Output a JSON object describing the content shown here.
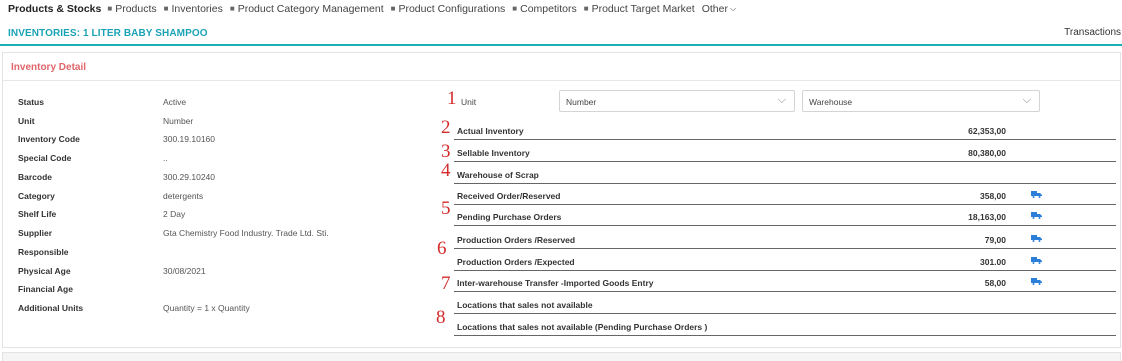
{
  "nav": {
    "brand": "Products & Stocks",
    "items": [
      "Products",
      "Inventories",
      "Product Category Management",
      "Product Configurations",
      "Competitors",
      "Product Target Market"
    ],
    "other": "Other"
  },
  "page": {
    "title": "INVENTORIES: 1 LITER BABY SHAMPOO",
    "transactions": "Transactions"
  },
  "panel": {
    "title": "Inventory Detail"
  },
  "details": [
    {
      "label": "Status",
      "value": "Active"
    },
    {
      "label": "Unit",
      "value": "Number"
    },
    {
      "label": "Inventory Code",
      "value": "300.19.10160"
    },
    {
      "label": "Special Code",
      "value": ".."
    },
    {
      "label": "Barcode",
      "value": "300.29.10240"
    },
    {
      "label": "Category",
      "value": "detergents"
    },
    {
      "label": "Shelf Life",
      "value": "2 Day"
    },
    {
      "label": "Supplier",
      "value": "Gta Chemistry Food Industry. Trade Ltd. Sti."
    },
    {
      "label": "Responsible",
      "value": ""
    },
    {
      "label": "Physical Age",
      "value": "30/08/2021"
    },
    {
      "label": "Financial Age",
      "value": ""
    },
    {
      "label": "Additional Units",
      "value": "Quantity = 1 x Quantity"
    }
  ],
  "unit_filter": {
    "label": "Unit",
    "unit_value": "Number",
    "warehouse_value": "Warehouse"
  },
  "annotations": [
    "1",
    "2",
    "3",
    "4",
    "5",
    "6",
    "7",
    "8"
  ],
  "inventory_rows": [
    {
      "label": "Actual Inventory",
      "value": "62,353,00",
      "truck": false
    },
    {
      "label": "Sellable Inventory",
      "value": "80,380,00",
      "truck": false
    },
    {
      "label": "Warehouse of Scrap",
      "value": "",
      "truck": false
    },
    {
      "label": "Received Order/Reserved",
      "value": "358,00",
      "truck": true
    },
    {
      "label": "Pending Purchase Orders",
      "value": "18,163,00",
      "truck": true
    },
    {
      "label": "Production Orders /Reserved",
      "value": "79,00",
      "truck": true
    },
    {
      "label": "Production Orders /Expected",
      "value": "301.00",
      "truck": true
    },
    {
      "label": "Inter-warehouse Transfer -Imported Goods Entry",
      "value": "58,00",
      "truck": true
    },
    {
      "label": "Locations that sales not available",
      "value": "",
      "truck": false
    },
    {
      "label": "Locations that sales not available (Pending Purchase Orders )",
      "value": "",
      "truck": false
    }
  ],
  "colors": {
    "accent": "#1aa3b5",
    "panel_title": "#e0666a",
    "annotation": "#d42b2b",
    "truck": "#2b7fd9"
  },
  "icons": {
    "truck": "truck-icon",
    "chevron": "chevron-down-icon",
    "dot": "bullet-icon"
  }
}
